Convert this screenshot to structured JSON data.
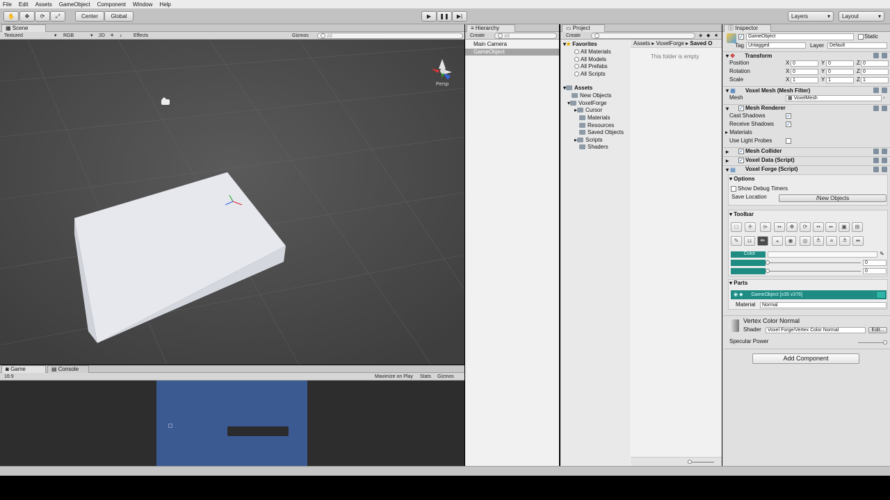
{
  "menu": [
    "File",
    "Edit",
    "Assets",
    "GameObject",
    "Component",
    "Window",
    "Help"
  ],
  "toolbar": {
    "pivot": "Center",
    "space": "Global",
    "layers": "Layers",
    "layout": "Layout"
  },
  "scene": {
    "tab": "Scene",
    "shading": "Textured",
    "render": "RGB",
    "mode2d": "2D",
    "effects": "Effects",
    "gizmos": "Gizmos",
    "search_placeholder": "All",
    "persp": "Persp"
  },
  "game": {
    "tab": "Game",
    "console_tab": "Console",
    "aspect": "16:9",
    "maximize": "Maximize on Play",
    "stats": "Stats",
    "gizmos": "Gizmos"
  },
  "hierarchy": {
    "tab": "Hierarchy",
    "create": "Create",
    "search_placeholder": "All",
    "items": [
      "Main Camera",
      "GameObject"
    ],
    "selected": "GameObject"
  },
  "project": {
    "tab": "Project",
    "create": "Create",
    "favorites_label": "Favorites",
    "favorites": [
      "All Materials",
      "All Models",
      "All Prefabs",
      "All Scripts"
    ],
    "assets_label": "Assets",
    "tree": [
      "New Objects",
      "VoxelForge",
      "Cursor",
      "Materials",
      "Resources",
      "Saved Objects",
      "Scripts",
      "Shaders"
    ],
    "breadcrumb": [
      "Assets",
      "VoxelForge",
      "Saved O"
    ],
    "empty": "This folder is empty"
  },
  "inspector": {
    "tab": "Inspector",
    "name": "GameObject",
    "static": "Static",
    "tag_label": "Tag",
    "tag": "Untagged",
    "layer_label": "Layer",
    "layer": "Default",
    "transform": {
      "title": "Transform",
      "position_label": "Position",
      "rotation_label": "Rotation",
      "scale_label": "Scale",
      "axes": [
        "X",
        "Y",
        "Z"
      ],
      "position": [
        "0",
        "0",
        "0"
      ],
      "rotation": [
        "0",
        "0",
        "0"
      ],
      "scale": [
        "1",
        "1",
        "1"
      ]
    },
    "mesh_filter": {
      "title": "Voxel Mesh (Mesh Filter)",
      "mesh_label": "Mesh",
      "mesh": "VoxelMesh"
    },
    "mesh_renderer": {
      "title": "Mesh Renderer",
      "cast_shadows": "Cast Shadows",
      "receive_shadows": "Receive Shadows",
      "materials": "Materials",
      "light_probes": "Use Light Probes"
    },
    "mesh_collider": "Mesh Collider",
    "voxel_data": "Voxel Data (Script)",
    "voxel_forge": "Voxel Forge (Script)",
    "options": {
      "title": "Options",
      "debug": "Show Debug Timers",
      "save_label": "Save Location",
      "save_value": "/New Objects"
    },
    "toolbar_title": "Toolbar",
    "color_label": "Color",
    "slider1": "0",
    "slider2": "0",
    "parts": {
      "title": "Parts",
      "item": "GameObject [x35 v376]",
      "material_label": "Material",
      "material": "Normal"
    },
    "material": {
      "name": "Vertex Color Normal",
      "shader_label": "Shader",
      "shader": "Voxel Forge/Vertex Color Normal",
      "edit": "Edit...",
      "specular": "Specular Power"
    },
    "add_component": "Add Component"
  },
  "colors": {
    "teal": "#1f8c84",
    "scene_bg": "#4a4a4a",
    "game_blue": "#3b5a92"
  }
}
